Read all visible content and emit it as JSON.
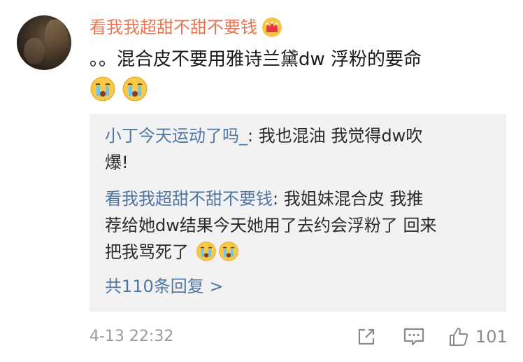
{
  "comment": {
    "username": "看我我超甜不甜不要钱",
    "text": "。。混合皮不要用雅诗兰黛dw 浮粉的要命",
    "emojis": [
      "crying-face",
      "crying-face"
    ],
    "badge_icon": "crown-icon"
  },
  "replies": [
    {
      "author": "小丁今天运动了吗_",
      "separator": ": ",
      "line1": "我也混油 我觉得dw吹",
      "line2": "爆!"
    },
    {
      "author": "看我我超甜不甜不要钱",
      "separator": ": ",
      "line1": "我姐妹混合皮 我推",
      "line2": "荐给她dw结果今天她用了去约会浮粉了 回来",
      "line3": "把我骂死了",
      "emojis": [
        "crying-face",
        "crying-face"
      ]
    }
  ],
  "more_replies_label": "共110条回复 >",
  "footer": {
    "timestamp": "4-13 22:32",
    "like_count": "101"
  },
  "colors": {
    "username": "#eb7350",
    "reply_author": "#5076a6",
    "reply_bg": "#f2f2f2",
    "muted": "#9a9a9a"
  }
}
